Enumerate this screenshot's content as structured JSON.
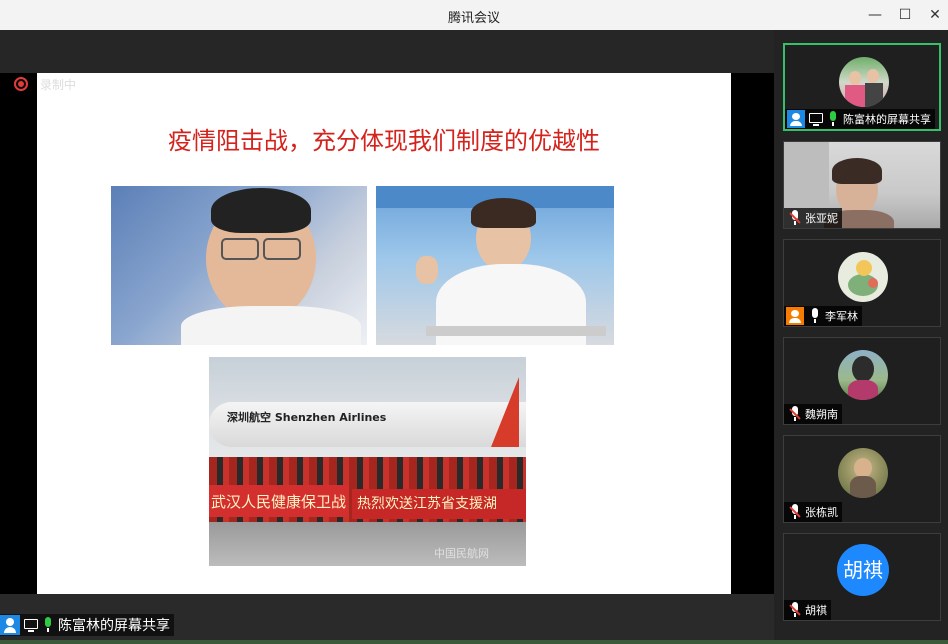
{
  "window": {
    "title": "腾讯会议",
    "minimize": "—",
    "maximize": "☐",
    "close": "✕"
  },
  "recording": {
    "label": "录制中"
  },
  "slide": {
    "title": "疫情阻击战，充分体现我们制度的优越性",
    "banner_left": "武汉人民健康保卫战",
    "banner_right": "热烈欢送江苏省支援湖",
    "plane_text": "深圳航空 Shenzhen Airlines",
    "watermark": "中国民航网"
  },
  "share": {
    "label": "陈富林的屏幕共享"
  },
  "participants": [
    {
      "name": "陈富林的屏幕共享",
      "type": "photo-avatar",
      "mic": "on",
      "active": true
    },
    {
      "name": "张亚妮",
      "type": "video",
      "mic": "off"
    },
    {
      "name": "李军林",
      "type": "photo-avatar",
      "mic": "on",
      "host": true
    },
    {
      "name": "魏朔南",
      "type": "photo-avatar",
      "mic": "off"
    },
    {
      "name": "张栋凯",
      "type": "photo-avatar",
      "mic": "off"
    },
    {
      "name": "胡祺",
      "type": "text-avatar",
      "avatar_text": "胡祺",
      "mic": "off"
    }
  ],
  "colors": {
    "accent": "#1e88e5",
    "active_border": "#37c06a",
    "slide_title": "#d4231d",
    "recording": "#e23b3b"
  }
}
